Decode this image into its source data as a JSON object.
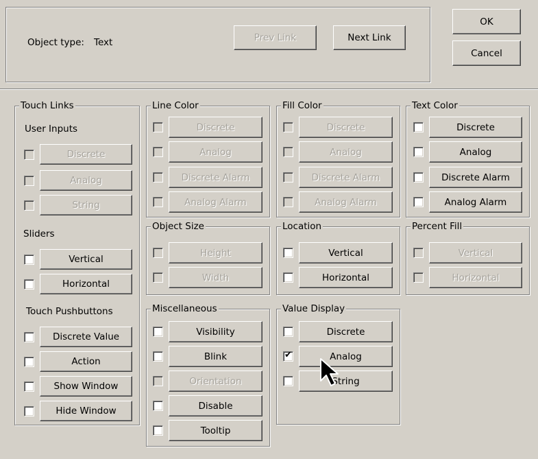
{
  "header": {
    "object_type_label": "Object type:",
    "object_type_value": "Text",
    "prev_link": "Prev Link",
    "next_link": "Next Link",
    "ok": "OK",
    "cancel": "Cancel"
  },
  "touch_links": {
    "title": "Touch Links",
    "user_inputs": {
      "title": "User Inputs",
      "items": [
        {
          "label": "Discrete",
          "checked": false,
          "enabled": false
        },
        {
          "label": "Analog",
          "checked": false,
          "enabled": false
        },
        {
          "label": "String",
          "checked": false,
          "enabled": false
        }
      ]
    },
    "sliders": {
      "title": "Sliders",
      "items": [
        {
          "label": "Vertical",
          "checked": false,
          "enabled": true
        },
        {
          "label": "Horizontal",
          "checked": false,
          "enabled": true
        }
      ]
    },
    "pushbuttons": {
      "title": "Touch Pushbuttons",
      "items": [
        {
          "label": "Discrete Value",
          "checked": false,
          "enabled": true
        },
        {
          "label": "Action",
          "checked": false,
          "enabled": true
        },
        {
          "label": "Show Window",
          "checked": false,
          "enabled": true
        },
        {
          "label": "Hide Window",
          "checked": false,
          "enabled": true
        }
      ]
    }
  },
  "line_color": {
    "title": "Line Color",
    "items": [
      {
        "label": "Discrete",
        "checked": false,
        "enabled": false
      },
      {
        "label": "Analog",
        "checked": false,
        "enabled": false
      },
      {
        "label": "Discrete Alarm",
        "checked": false,
        "enabled": false
      },
      {
        "label": "Analog Alarm",
        "checked": false,
        "enabled": false
      }
    ]
  },
  "fill_color": {
    "title": "Fill Color",
    "items": [
      {
        "label": "Discrete",
        "checked": false,
        "enabled": false
      },
      {
        "label": "Analog",
        "checked": false,
        "enabled": false
      },
      {
        "label": "Discrete Alarm",
        "checked": false,
        "enabled": false
      },
      {
        "label": "Analog Alarm",
        "checked": false,
        "enabled": false
      }
    ]
  },
  "text_color": {
    "title": "Text Color",
    "items": [
      {
        "label": "Discrete",
        "checked": false,
        "enabled": true
      },
      {
        "label": "Analog",
        "checked": false,
        "enabled": true
      },
      {
        "label": "Discrete Alarm",
        "checked": false,
        "enabled": true
      },
      {
        "label": "Analog Alarm",
        "checked": false,
        "enabled": true
      }
    ]
  },
  "object_size": {
    "title": "Object Size",
    "items": [
      {
        "label": "Height",
        "checked": false,
        "enabled": false
      },
      {
        "label": "Width",
        "checked": false,
        "enabled": false
      }
    ]
  },
  "location": {
    "title": "Location",
    "items": [
      {
        "label": "Vertical",
        "checked": false,
        "enabled": true
      },
      {
        "label": "Horizontal",
        "checked": false,
        "enabled": true
      }
    ]
  },
  "percent_fill": {
    "title": "Percent Fill",
    "items": [
      {
        "label": "Vertical",
        "checked": false,
        "enabled": false
      },
      {
        "label": "Horizontal",
        "checked": false,
        "enabled": false
      }
    ]
  },
  "miscellaneous": {
    "title": "Miscellaneous",
    "items": [
      {
        "label": "Visibility",
        "checked": false,
        "enabled": true
      },
      {
        "label": "Blink",
        "checked": false,
        "enabled": true
      },
      {
        "label": "Orientation",
        "checked": false,
        "enabled": false
      },
      {
        "label": "Disable",
        "checked": false,
        "enabled": true
      },
      {
        "label": "Tooltip",
        "checked": false,
        "enabled": true
      }
    ]
  },
  "value_display": {
    "title": "Value Display",
    "items": [
      {
        "label": "Discrete",
        "checked": false,
        "enabled": true
      },
      {
        "label": "Analog",
        "checked": true,
        "enabled": true
      },
      {
        "label": "String",
        "checked": false,
        "enabled": true
      }
    ]
  },
  "check_mark": "✔",
  "colors": {
    "face": "#d4d0c8",
    "shadow": "#808080",
    "highlight": "#ffffff",
    "disabled_text": "#a6a39c"
  }
}
